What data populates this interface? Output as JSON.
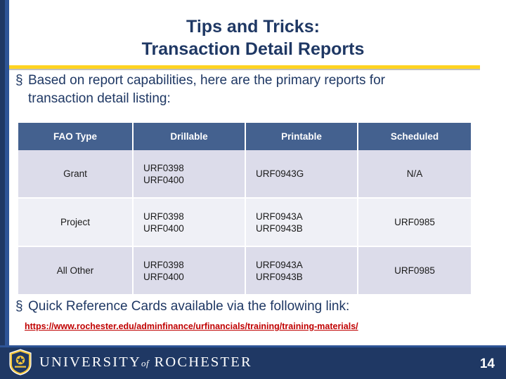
{
  "slide": {
    "title_line1": "Tips and Tricks:",
    "title_line2": "Transaction Detail Reports",
    "bullet1": {
      "marker": "§",
      "text": "Based on report capabilities, here are the primary reports for transaction detail listing:"
    },
    "bullet2": {
      "marker": "§",
      "text": "Quick Reference Cards available via the following link:"
    },
    "link": "https://www.rochester.edu/adminfinance/urfinancials/training/training-materials/",
    "page_number": "14"
  },
  "table": {
    "headers": [
      "FAO Type",
      "Drillable",
      "Printable",
      "Scheduled"
    ],
    "rows": [
      {
        "fao_type": "Grant",
        "drillable": [
          "URF0398",
          "URF0400"
        ],
        "printable": [
          "URF0943G"
        ],
        "scheduled": [
          "N/A"
        ]
      },
      {
        "fao_type": "Project",
        "drillable": [
          "URF0398",
          "URF0400"
        ],
        "printable": [
          "URF0943A",
          "URF0943B"
        ],
        "scheduled": [
          "URF0985"
        ]
      },
      {
        "fao_type": "All Other",
        "drillable": [
          "URF0398",
          "URF0400"
        ],
        "printable": [
          "URF0943A",
          "URF0943B"
        ],
        "scheduled": [
          "URF0985"
        ]
      }
    ]
  },
  "footer": {
    "university_word": "UNIVERSITY",
    "of_word": "of",
    "rochester_word": "ROCHESTER"
  },
  "colors": {
    "navy": "#1f3864",
    "header_blue": "#44618f",
    "accent_yellow": "#ffd320",
    "link_red": "#c00000",
    "row_odd": "#dcdcea",
    "row_even": "#eff0f6"
  }
}
